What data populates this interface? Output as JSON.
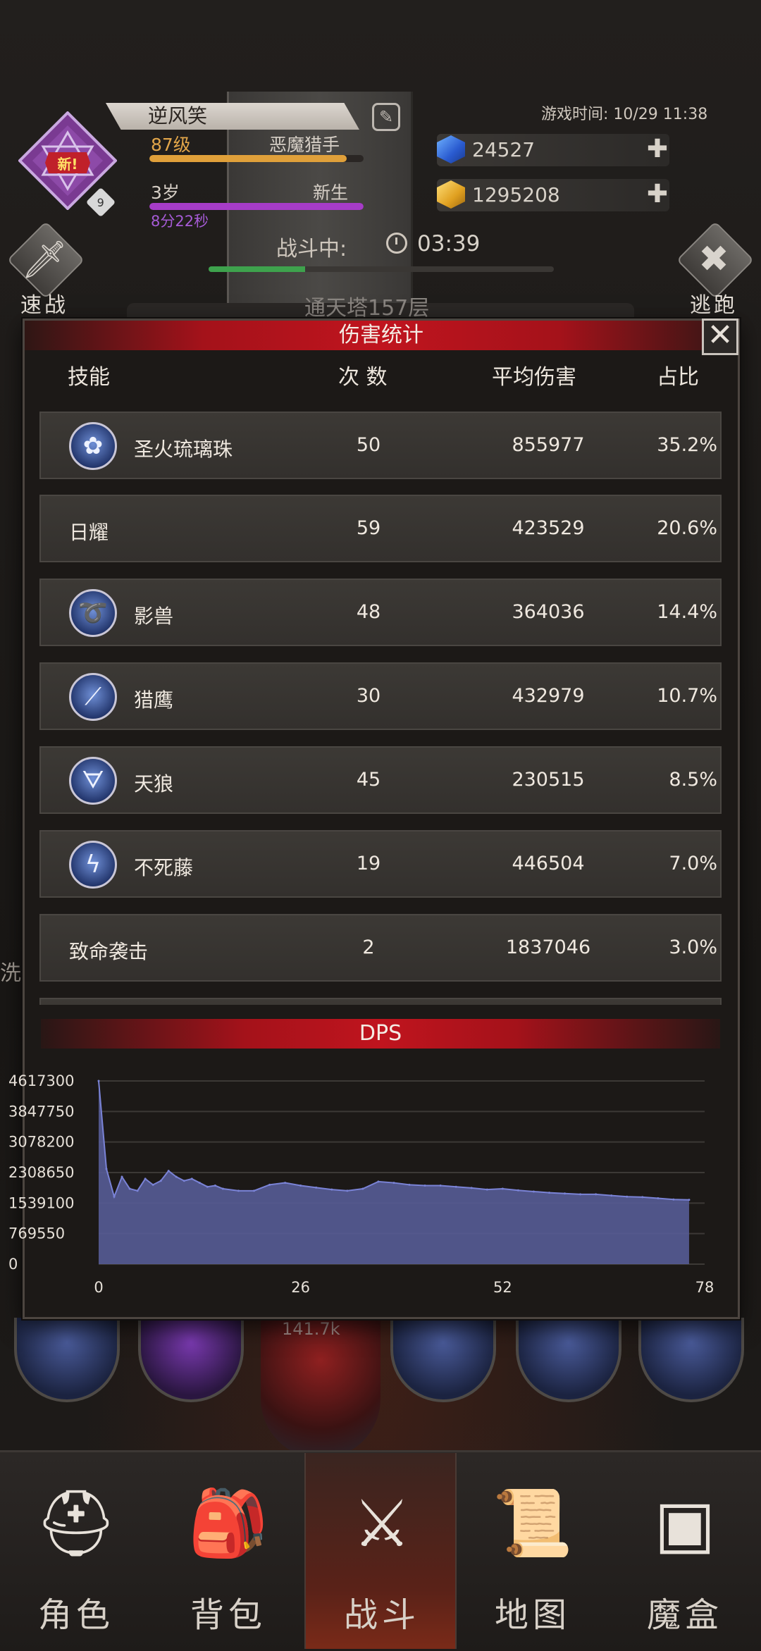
{
  "header": {
    "player_name": "逆风笑",
    "new_tag": "新!",
    "emblem_level": "9",
    "level_text": "87级",
    "class_text": "恶魔猎手",
    "age_text": "3岁",
    "stage_text": "新生",
    "age_timer": "8分22秒",
    "game_time": "游戏时间: 10/29 11:38",
    "gems": "24527",
    "gold": "1295208",
    "battle_label": "战斗中:",
    "battle_time": "03:39",
    "battle_progress": 0.28,
    "quick_battle": "速战",
    "escape": "逃跑",
    "floor": "通天塔157层",
    "left_glimpse": "洗"
  },
  "colors": {
    "accent_red": "#c0141e",
    "level_bar": "#e0a03a",
    "age_bar": "#a63cc8",
    "progress": "#3ea24d",
    "dps_fill": "#565c96",
    "dps_line": "#7a83d6"
  },
  "damage_panel": {
    "title": "伤害统计",
    "close_icon": "close-icon",
    "columns": {
      "skill": "技能",
      "count": "次 数",
      "avg": "平均伤害",
      "share": "占比"
    },
    "rows": [
      {
        "name": "圣火琉璃珠",
        "count": "50",
        "avg": "855977",
        "share": "35.2%",
        "icon": "orb-flower-icon",
        "glyph": "✿"
      },
      {
        "name": "日耀",
        "count": "59",
        "avg": "423529",
        "share": "20.6%",
        "icon": "",
        "glyph": ""
      },
      {
        "name": "影兽",
        "count": "48",
        "avg": "364036",
        "share": "14.4%",
        "icon": "shadow-beast-icon",
        "glyph": "➰"
      },
      {
        "name": "猎鹰",
        "count": "30",
        "avg": "432979",
        "share": "10.7%",
        "icon": "falcon-claw-icon",
        "glyph": "⟋"
      },
      {
        "name": "天狼",
        "count": "45",
        "avg": "230515",
        "share": "8.5%",
        "icon": "wolf-fang-icon",
        "glyph": "ᗊ"
      },
      {
        "name": "不死藤",
        "count": "19",
        "avg": "446504",
        "share": "7.0%",
        "icon": "undying-vine-icon",
        "glyph": "ϟ"
      },
      {
        "name": "致命袭击",
        "count": "2",
        "avg": "1837046",
        "share": "3.0%",
        "icon": "",
        "glyph": ""
      }
    ]
  },
  "chart_data": {
    "type": "area",
    "title": "DPS",
    "xlabel": "",
    "ylabel": "",
    "x_ticks": [
      "0",
      "26",
      "52",
      "78"
    ],
    "y_ticks": [
      "4617300",
      "3847750",
      "3078200",
      "2308650",
      "1539100",
      "769550",
      "0"
    ],
    "xlim": [
      0,
      78
    ],
    "ylim": [
      0,
      4617300
    ],
    "grid": true,
    "x": [
      0,
      1,
      2,
      3,
      4,
      5,
      6,
      7,
      8,
      9,
      10,
      11,
      12,
      13,
      14,
      15,
      16,
      18,
      20,
      22,
      24,
      26,
      28,
      30,
      32,
      34,
      36,
      38,
      40,
      42,
      44,
      46,
      48,
      50,
      52,
      54,
      56,
      58,
      60,
      62,
      64,
      66,
      68,
      70,
      72,
      74,
      76
    ],
    "values": [
      4617300,
      2400000,
      1700000,
      2200000,
      1900000,
      1850000,
      2150000,
      2000000,
      2100000,
      2350000,
      2200000,
      2100000,
      2150000,
      2050000,
      1950000,
      1980000,
      1900000,
      1850000,
      1850000,
      2000000,
      2050000,
      1980000,
      1930000,
      1880000,
      1850000,
      1900000,
      2080000,
      2050000,
      2000000,
      1980000,
      1980000,
      1950000,
      1920000,
      1880000,
      1900000,
      1860000,
      1830000,
      1800000,
      1780000,
      1760000,
      1760000,
      1730000,
      1700000,
      1690000,
      1660000,
      1630000,
      1620000
    ]
  },
  "nav": {
    "items": [
      {
        "label": "角色",
        "icon": "helmet-icon",
        "glyph": "⛑"
      },
      {
        "label": "背包",
        "icon": "backpack-icon",
        "glyph": "🎒"
      },
      {
        "label": "战斗",
        "icon": "shield-sword-icon",
        "glyph": "⚔"
      },
      {
        "label": "地图",
        "icon": "map-scroll-icon",
        "glyph": "📜"
      },
      {
        "label": "魔盒",
        "icon": "magic-box-icon",
        "glyph": "▣"
      }
    ],
    "active_index": 2
  },
  "battle_orb_text": "141.7k"
}
